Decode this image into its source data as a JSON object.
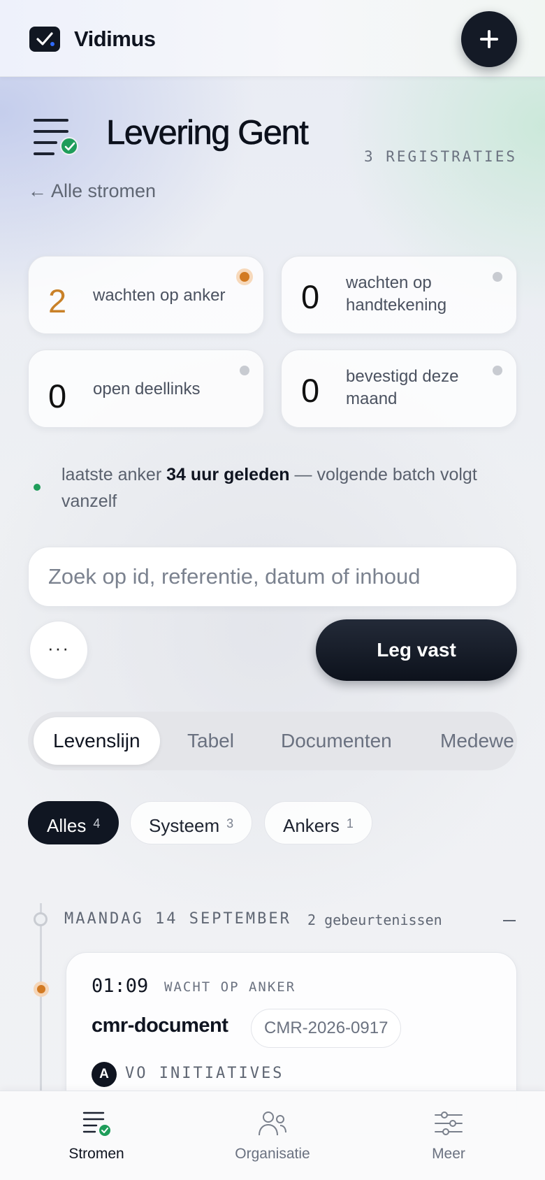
{
  "app": {
    "name": "Vidimus"
  },
  "header": {
    "title": "Levering Gent",
    "registrations": "3 REGISTRATIES",
    "back_link": "← Alle stromen"
  },
  "stats": [
    {
      "value": "2",
      "label": "wachten op anker",
      "status": "warning"
    },
    {
      "value": "0",
      "label": "wachten op handtekening",
      "status": "neutral"
    },
    {
      "value": "0",
      "label": "open deellinks",
      "status": "neutral"
    },
    {
      "value": "0",
      "label": "bevestigd deze maand",
      "status": "neutral"
    }
  ],
  "anchor_note": {
    "prefix": "laatste anker",
    "emphasis": "34 uur geleden",
    "suffix": "— volgende batch volgt vanzelf"
  },
  "search": {
    "placeholder": "Zoek op id, referentie, datum of inhoud",
    "value": ""
  },
  "actions": {
    "more_label": "···",
    "primary_label": "Leg vast"
  },
  "tabs": [
    {
      "label": "Levenslijn",
      "active": true
    },
    {
      "label": "Tabel",
      "active": false
    },
    {
      "label": "Documenten",
      "active": false
    },
    {
      "label": "Medewe",
      "active": false
    }
  ],
  "filters": [
    {
      "label": "Alles",
      "count": "4",
      "active": true
    },
    {
      "label": "Systeem",
      "count": "3",
      "active": false
    },
    {
      "label": "Ankers",
      "count": "1",
      "active": false
    }
  ],
  "timeline": {
    "day_label": "MAANDAG 14 SEPTEMBER",
    "day_count": "2 gebeurtenissen",
    "events": [
      {
        "time": "01:09",
        "status": "WACHT OP ANKER",
        "type": "cmr-document",
        "reference": "CMR-2026-0917",
        "avatar_letter": "A",
        "organisation": "VO INITIATIVES"
      }
    ]
  },
  "bottom_nav": [
    {
      "label": "Stromen",
      "icon": "stream-check-icon",
      "active": true
    },
    {
      "label": "Organisatie",
      "icon": "people-icon",
      "active": false
    },
    {
      "label": "Meer",
      "icon": "sliders-icon",
      "active": false
    }
  ],
  "colors": {
    "accent_dark": "#101622",
    "warning": "#d27a22",
    "success": "#1f9d5a",
    "muted_text": "#6b7280"
  }
}
